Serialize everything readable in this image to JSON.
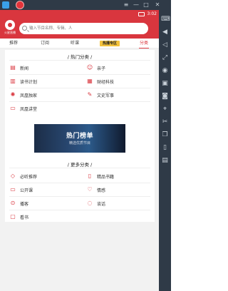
{
  "status_bar": {
    "time": "3:02"
  },
  "header": {
    "logo_text": "火星直播",
    "search_placeholder": "输入节目名称、专辑、人"
  },
  "tabs": [
    {
      "label": "推荐"
    },
    {
      "label": "订阅"
    },
    {
      "label": "听课"
    },
    {
      "label": "热播专区"
    },
    {
      "label": "分类"
    }
  ],
  "hot": {
    "title": "/ 热门分类 /",
    "items": [
      {
        "label": "新闻",
        "icon": "news-icon"
      },
      {
        "label": "亲子",
        "icon": "baby-icon"
      },
      {
        "label": "读书计划",
        "icon": "book-icon"
      },
      {
        "label": "财经科技",
        "icon": "finance-icon"
      },
      {
        "label": "凤凰独家",
        "icon": "phoenix-icon"
      },
      {
        "label": "文史军事",
        "icon": "history-icon"
      },
      {
        "label": "凤凰讲堂",
        "icon": "lecture-icon"
      }
    ]
  },
  "banner": {
    "title": "热门榜单",
    "subtitle": "精选优质节目"
  },
  "more": {
    "title": "/ 更多分类 /",
    "items": [
      {
        "label": "必听推荐",
        "icon": "diamond-icon"
      },
      {
        "label": "精品书籍",
        "icon": "books-icon"
      },
      {
        "label": "公开课",
        "icon": "open-course-icon"
      },
      {
        "label": "情感",
        "icon": "heart-icon"
      },
      {
        "label": "播客",
        "icon": "podcast-icon"
      },
      {
        "label": "谈话",
        "icon": "talk-icon"
      },
      {
        "label": "看书",
        "icon": "reading-icon"
      }
    ]
  }
}
